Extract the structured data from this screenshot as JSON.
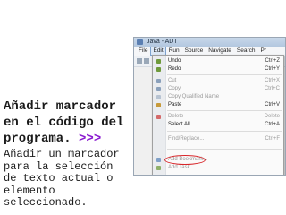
{
  "slide": {
    "title": "Añadir marcador en el código del programa.",
    "title_arrows": ">>>",
    "body": "Añadir un marcador para la selección de texto actual o elemento seleccionado."
  },
  "window": {
    "title": "Java - ADT",
    "menus": [
      "File",
      "Edit",
      "Run",
      "Source",
      "Navigate",
      "Search",
      "Pr"
    ]
  },
  "edit_menu": {
    "undo": {
      "label": "Undo",
      "shortcut": "Ctrl+Z"
    },
    "redo": {
      "label": "Redo",
      "shortcut": "Ctrl+Y"
    },
    "cut": {
      "label": "Cut",
      "shortcut": "Ctrl+X"
    },
    "copy": {
      "label": "Copy",
      "shortcut": "Ctrl+C"
    },
    "copy_qualified": {
      "label": "Copy Qualified Name"
    },
    "paste": {
      "label": "Paste",
      "shortcut": "Ctrl+V"
    },
    "delete": {
      "label": "Delete",
      "shortcut": "Delete"
    },
    "select_all": {
      "label": "Select All",
      "shortcut": "Ctrl+A"
    },
    "find_replace": {
      "label": "Find/Replace...",
      "shortcut": "Ctrl+F"
    },
    "add_bookmark": {
      "label": "Add Bookmark..."
    },
    "add_task": {
      "label": "Add Task..."
    }
  },
  "colors": {
    "accent_arrows": "#8a1ad0",
    "highlight_oval": "#d8262a"
  }
}
